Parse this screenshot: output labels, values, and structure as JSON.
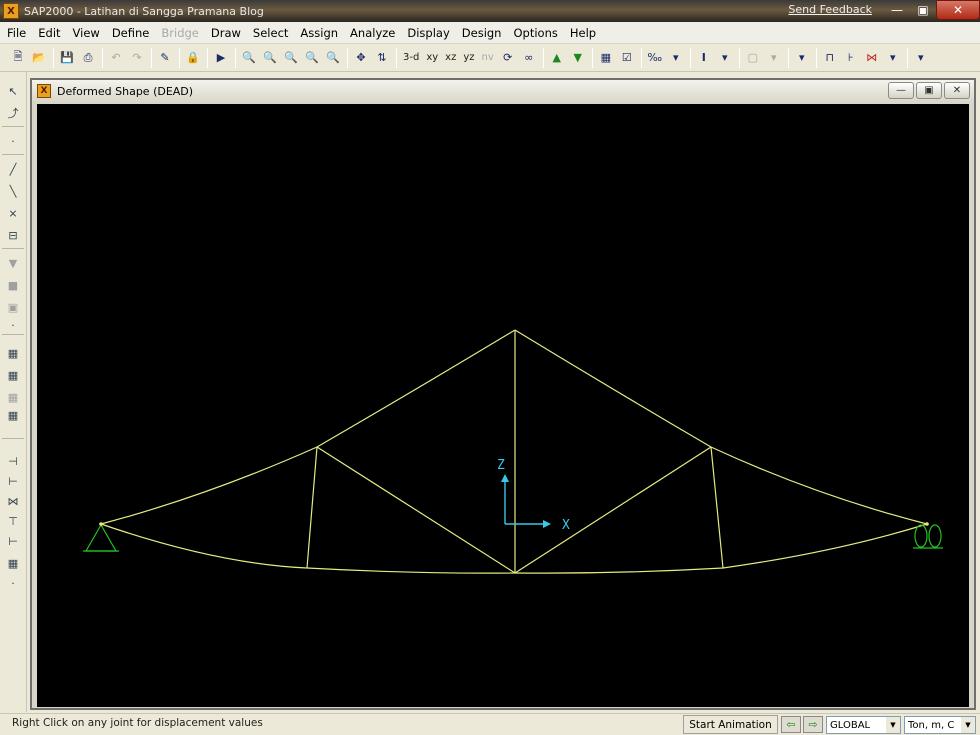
{
  "app": {
    "title": "SAP2000 - Latihan di Sangga Pramana Blog",
    "icon_glyph": "X",
    "send_feedback": "Send Feedback"
  },
  "menu": [
    {
      "label": "File",
      "enabled": true
    },
    {
      "label": "Edit",
      "enabled": true
    },
    {
      "label": "View",
      "enabled": true
    },
    {
      "label": "Define",
      "enabled": true
    },
    {
      "label": "Bridge",
      "enabled": false
    },
    {
      "label": "Draw",
      "enabled": true
    },
    {
      "label": "Select",
      "enabled": true
    },
    {
      "label": "Assign",
      "enabled": true
    },
    {
      "label": "Analyze",
      "enabled": true
    },
    {
      "label": "Display",
      "enabled": true
    },
    {
      "label": "Design",
      "enabled": true
    },
    {
      "label": "Options",
      "enabled": true
    },
    {
      "label": "Help",
      "enabled": true
    }
  ],
  "toolbar": {
    "view_3d": "3-d",
    "view_xy": "xy",
    "view_xz": "xz",
    "view_yz": "yz",
    "view_nv": "nv"
  },
  "window": {
    "title": "Deformed Shape (DEAD)"
  },
  "axes": {
    "z_label": "Z",
    "x_label": "X"
  },
  "colors": {
    "frame": "#e6ea82",
    "support": "#22c222",
    "axis": "#38c8e8",
    "background": "#000000"
  },
  "status": {
    "message": "Right Click on any joint for displacement values",
    "animation_button": "Start Animation",
    "coord_system": "GLOBAL",
    "units": "Ton, m, C"
  }
}
